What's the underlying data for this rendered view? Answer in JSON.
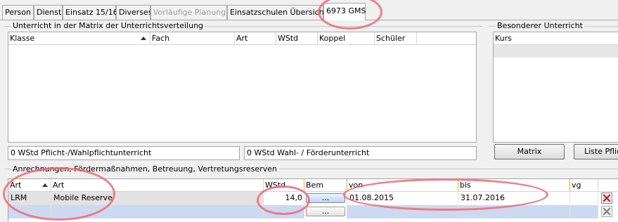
{
  "tabs": [
    {
      "label": "Person"
    },
    {
      "label": "Dienst"
    },
    {
      "label": "Einsatz 15/16"
    },
    {
      "label": "Diverses"
    },
    {
      "label": "Vorläufige Planung"
    },
    {
      "label": "Einsatzschulen Übersicht"
    },
    {
      "label": "6973 GMS"
    }
  ],
  "matrix": {
    "title": "Unterricht in der Matrix der Unterrichtsverteilung",
    "columns": [
      "Klasse",
      "Fach",
      "Art",
      "WStd",
      "Koppel",
      "Schüler"
    ],
    "sum_pflicht": "0 WStd Pflicht-/Wahlpflichtunterricht",
    "sum_wahl": "0 WStd Wahl- / Förderunterricht"
  },
  "besonderer": {
    "title": "Besonderer Unterricht",
    "column": "Kurs",
    "btn_matrix": "Matrix",
    "btn_liste": "Liste Pflich"
  },
  "anrechnungen": {
    "title": "Anrechnungen, Fördermaßnahmen, Betreuung, Vertretungsreserven",
    "columns": [
      "Art",
      "Art",
      "WStd",
      "Bem",
      "von",
      "bis",
      "vg"
    ],
    "rows": [
      {
        "art": "LRM",
        "art_name": "Mobile Reserve",
        "wstd": "14,0",
        "bem": "...",
        "von": "01.08.2015",
        "bis": "31.07.2016",
        "vg": ""
      },
      {
        "art": "",
        "art_name": "",
        "wstd": "",
        "bem": "...",
        "von": "",
        "bis": "",
        "vg": ""
      }
    ]
  }
}
